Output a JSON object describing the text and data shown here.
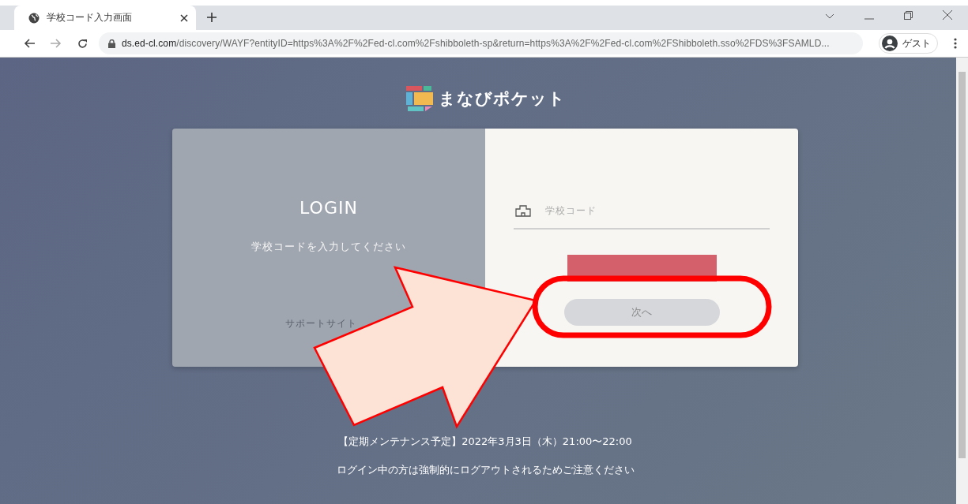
{
  "browser": {
    "tab": {
      "title": "学校コード入力画面",
      "selected": true
    },
    "address": {
      "host": "ds.ed-cl.com",
      "path": "/discovery/WAYF?entityID=https%3A%2F%2Fed-cl.com%2Fshibboleth-sp&return=https%3A%2F%2Fed-cl.com%2FShibboleth.sso%2FDS%3FSAMLD..."
    },
    "profile": "ゲスト"
  },
  "logo": "まなびポケット",
  "login_panel": {
    "title": "LOGIN",
    "instruction": "学校コードを入力してください",
    "support_link": "サポートサイト"
  },
  "form": {
    "school_code": {
      "placeholder": "学校コード"
    },
    "next_button": {
      "label": "次へ",
      "disabled": true
    }
  },
  "notices": [
    "【定期メンテナンス予定】2022年3月3日（木）21:00〜22:00",
    "ログイン中の方は強制的にログアウトされるためご注意ください"
  ]
}
